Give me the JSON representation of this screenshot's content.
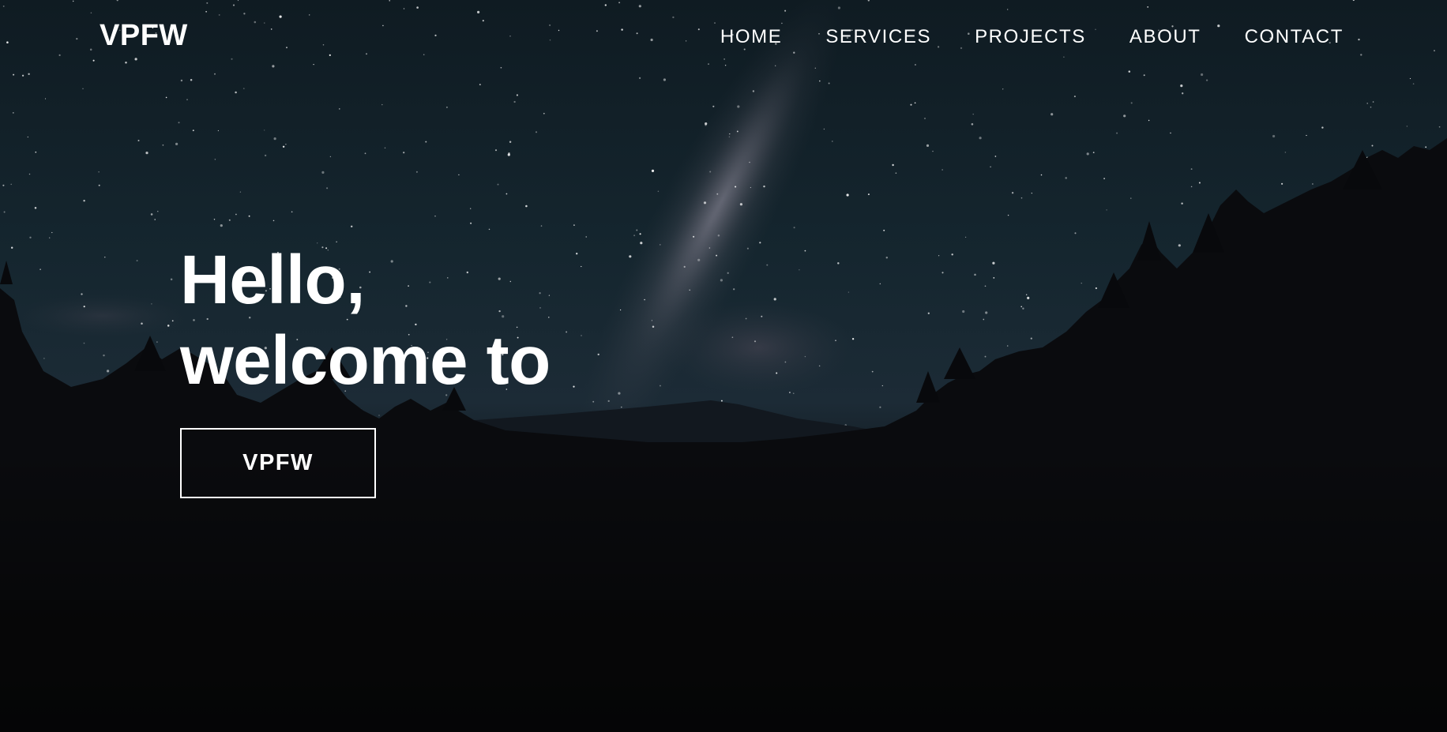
{
  "header": {
    "logo_text": "VPFW"
  },
  "nav": {
    "items": [
      {
        "label": "HOME"
      },
      {
        "label": "SERVICES"
      },
      {
        "label": "PROJECTS"
      },
      {
        "label": "ABOUT"
      },
      {
        "label": "CONTACT"
      }
    ]
  },
  "hero": {
    "headline_line1": "Hello,",
    "headline_line2": "welcome to",
    "cta_label": "VPFW"
  },
  "theme": {
    "text_color": "#ffffff",
    "sky_top": "#0f1d26",
    "sky_horizon": "#2a3a48",
    "forest": "#0a0a0e"
  },
  "background": {
    "scene": "starry-night-sky-milky-way-over-forest-icon"
  }
}
